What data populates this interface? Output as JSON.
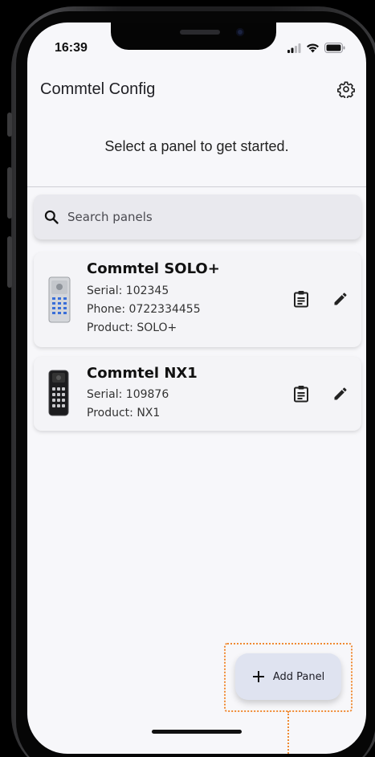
{
  "status_bar": {
    "time": "16:39",
    "icons": [
      "signal-icon",
      "wifi-icon",
      "battery-icon"
    ]
  },
  "app": {
    "title": "Commtel Config",
    "settings_icon": "gear-icon"
  },
  "prompt": "Select a panel to get started.",
  "search": {
    "placeholder": "Search panels",
    "value": ""
  },
  "panels": [
    {
      "name": "Commtel SOLO+",
      "serial": "Serial: 102345",
      "phone": "Phone: 0722334455",
      "product": "Product: SOLO+",
      "image_icon": "silver-intercom-panel",
      "actions": [
        "clipboard-icon",
        "pencil-icon"
      ]
    },
    {
      "name": "Commtel NX1",
      "serial": "Serial: 109876",
      "product": "Product: NX1",
      "image_icon": "black-keypad-panel",
      "actions": [
        "clipboard-icon",
        "pencil-icon"
      ]
    }
  ],
  "fab": {
    "label": "Add Panel",
    "icon": "plus-icon"
  },
  "colors": {
    "screen_bg": "#f7f7fa",
    "fab_bg": "#dfe3f0",
    "highlight": "#f08a32"
  }
}
